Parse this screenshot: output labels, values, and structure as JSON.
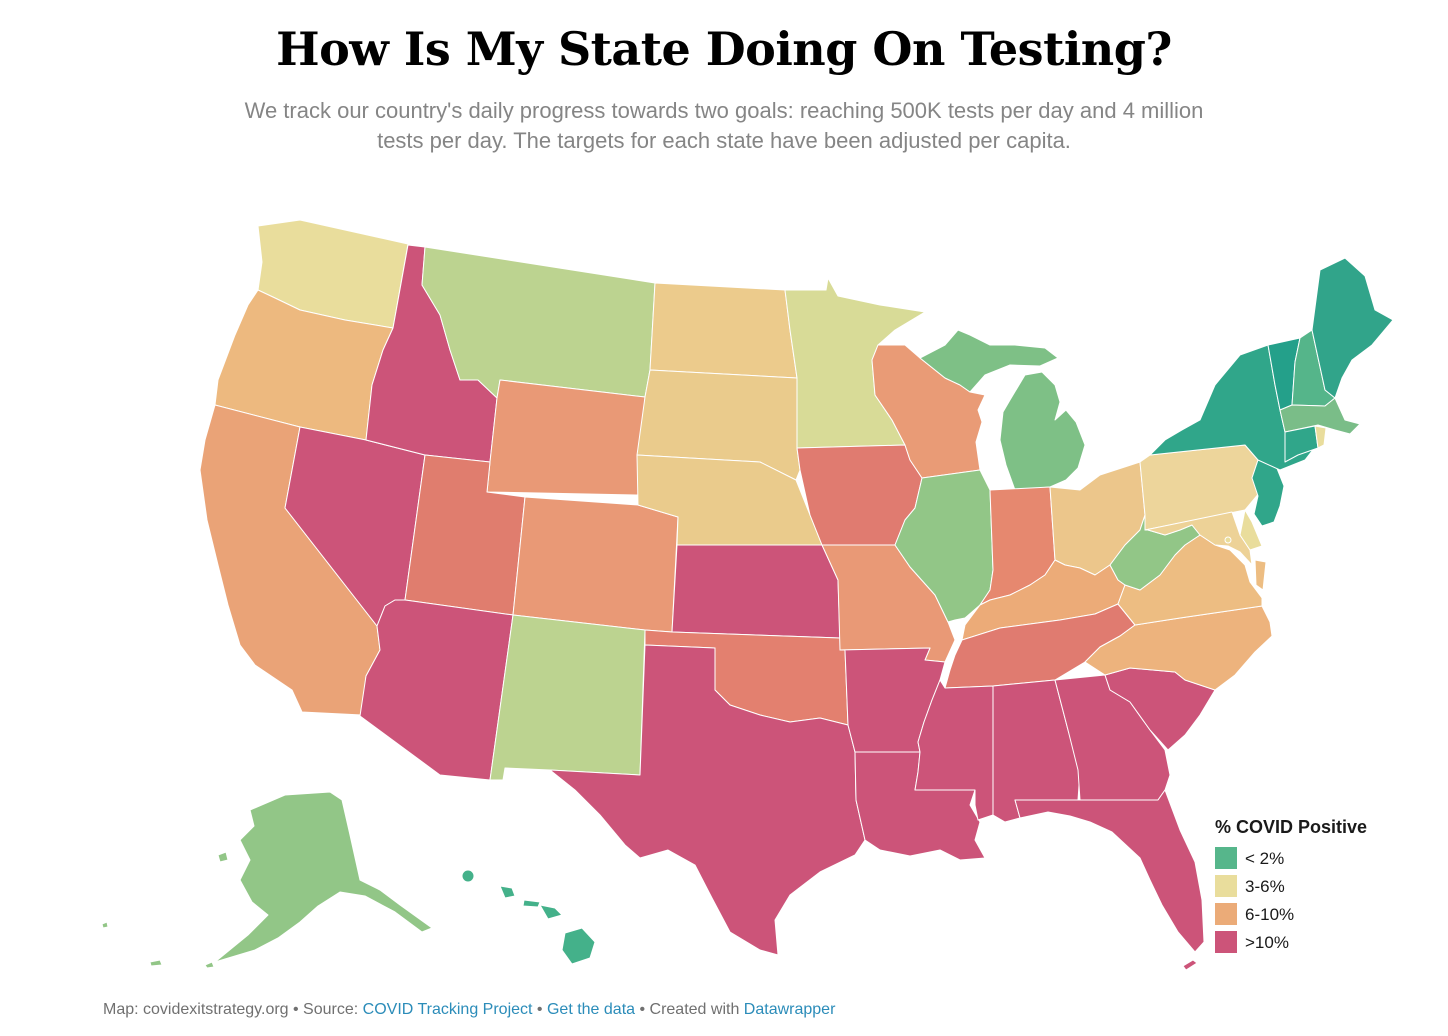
{
  "title": "How Is My State Doing On Testing?",
  "subtitle_lines": [
    "We track our country's daily progress towards two goals: reaching 500K tests per day and 4 million",
    "tests per day. The targets for each state have been adjusted per capita."
  ],
  "legend": {
    "title": "% COVID Positive",
    "items": [
      {
        "label": "< 2%",
        "color": "#56b68b"
      },
      {
        "label": "3-6%",
        "color": "#e9dd9c"
      },
      {
        "label": "6-10%",
        "color": "#ebab78"
      },
      {
        "label": ">10%",
        "color": "#cc5479"
      }
    ]
  },
  "state_fills": {
    "WA": "#e9dd9c",
    "OR": "#edb97f",
    "CA": "#eaa377",
    "ID": "#cc5479",
    "NV": "#cc5479",
    "AZ": "#cc5479",
    "MT": "#bcd390",
    "WY": "#e99976",
    "UT": "#e07d6e",
    "CO": "#e99976",
    "NM": "#bcd390",
    "ND": "#eccb8c",
    "SD": "#eacb8c",
    "NE": "#eacb8c",
    "KS": "#cc5479",
    "OK": "#e3806f",
    "TX": "#cc5479",
    "MN": "#d8db97",
    "IA": "#e07b70",
    "MO": "#e99976",
    "AR": "#cc5479",
    "LA": "#cc5479",
    "WI": "#e99b76",
    "MI": "#7ec086",
    "IL": "#92c687",
    "IN": "#e6886f",
    "OH": "#ecc68b",
    "KY": "#ecab78",
    "TN": "#e07b70",
    "MS": "#cc5479",
    "AL": "#cc5479",
    "GA": "#cc5479",
    "FL": "#cc5479",
    "SC": "#cc5479",
    "NC": "#edb37d",
    "VA": "#edbd82",
    "WV": "#92c687",
    "PA": "#edd59b",
    "NY": "#30a68a",
    "VT": "#24a08a",
    "NH": "#55b58a",
    "ME": "#31a48a",
    "MA": "#7abd88",
    "RI": "#e9dd9c",
    "CT": "#30a68a",
    "NJ": "#30a68a",
    "DE": "#e9dd9c",
    "MD": "#edd297",
    "DC": "#e9dd9c",
    "AK": "#92c687",
    "HI": "#44b18a"
  },
  "footer": {
    "prefix": "Map: covidexitstrategy.org • Source: ",
    "source_link": "COVID Tracking Project",
    "sep1": " • ",
    "data_link": "Get the data",
    "sep2": " • Created with ",
    "credit_link": "Datawrapper"
  },
  "colors": {
    "link": "#2b8cb9",
    "footer_text": "#707070"
  }
}
